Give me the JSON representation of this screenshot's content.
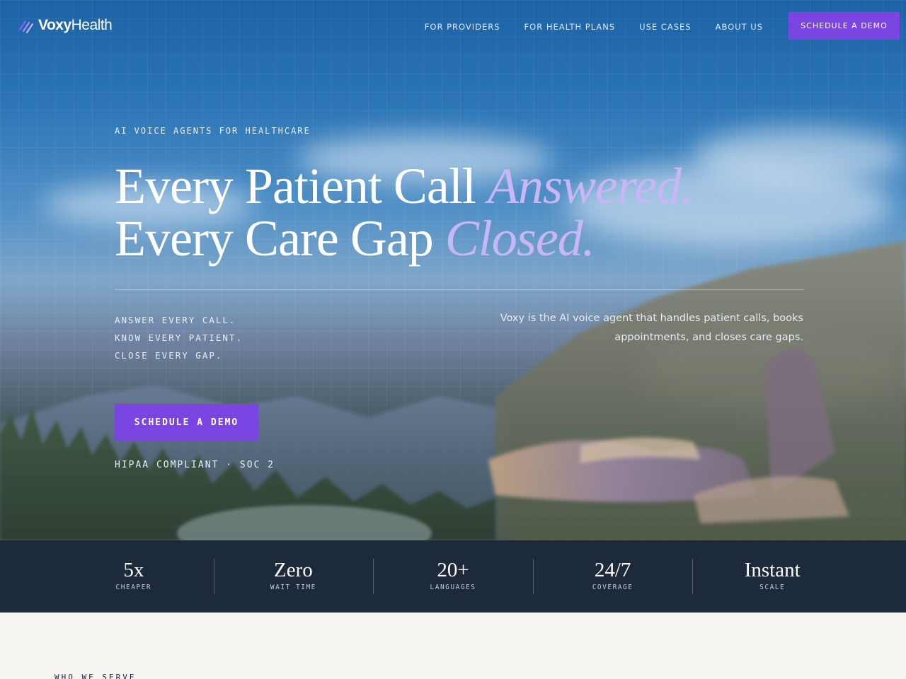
{
  "brand": {
    "name_part1": "Voxy",
    "name_part2": "Health",
    "logo_icon": "voxy-wave-icon",
    "accent_color": "#7a45e0"
  },
  "nav": {
    "links": [
      "FOR PROVIDERS",
      "FOR HEALTH PLANS",
      "USE CASES",
      "ABOUT US"
    ],
    "cta_label": "SCHEDULE A DEMO"
  },
  "hero": {
    "eyebrow": "AI VOICE AGENTS FOR HEALTHCARE",
    "headline_line1_plain": "Every Patient Call ",
    "headline_line1_accent": "Answered.",
    "headline_line2_plain": "Every Care Gap ",
    "headline_line2_accent": "Closed.",
    "tagline": [
      "ANSWER EVERY CALL.",
      "KNOW EVERY PATIENT.",
      "CLOSE EVERY GAP."
    ],
    "description": "Voxy is the AI voice agent that handles patient calls, books appointments, and closes care gaps.",
    "cta_label": "SCHEDULE A DEMO",
    "compliance": "HIPAA COMPLIANT · SOC 2",
    "accent_color": "#c9b6f6"
  },
  "stats": [
    {
      "value": "5x",
      "label": "CHEAPER"
    },
    {
      "value": "Zero",
      "label": "WAIT TIME"
    },
    {
      "value": "20+",
      "label": "LANGUAGES"
    },
    {
      "value": "24/7",
      "label": "COVERAGE"
    },
    {
      "value": "Instant",
      "label": "SCALE"
    }
  ],
  "next_section": {
    "eyebrow": "WHO WE SERVE"
  }
}
